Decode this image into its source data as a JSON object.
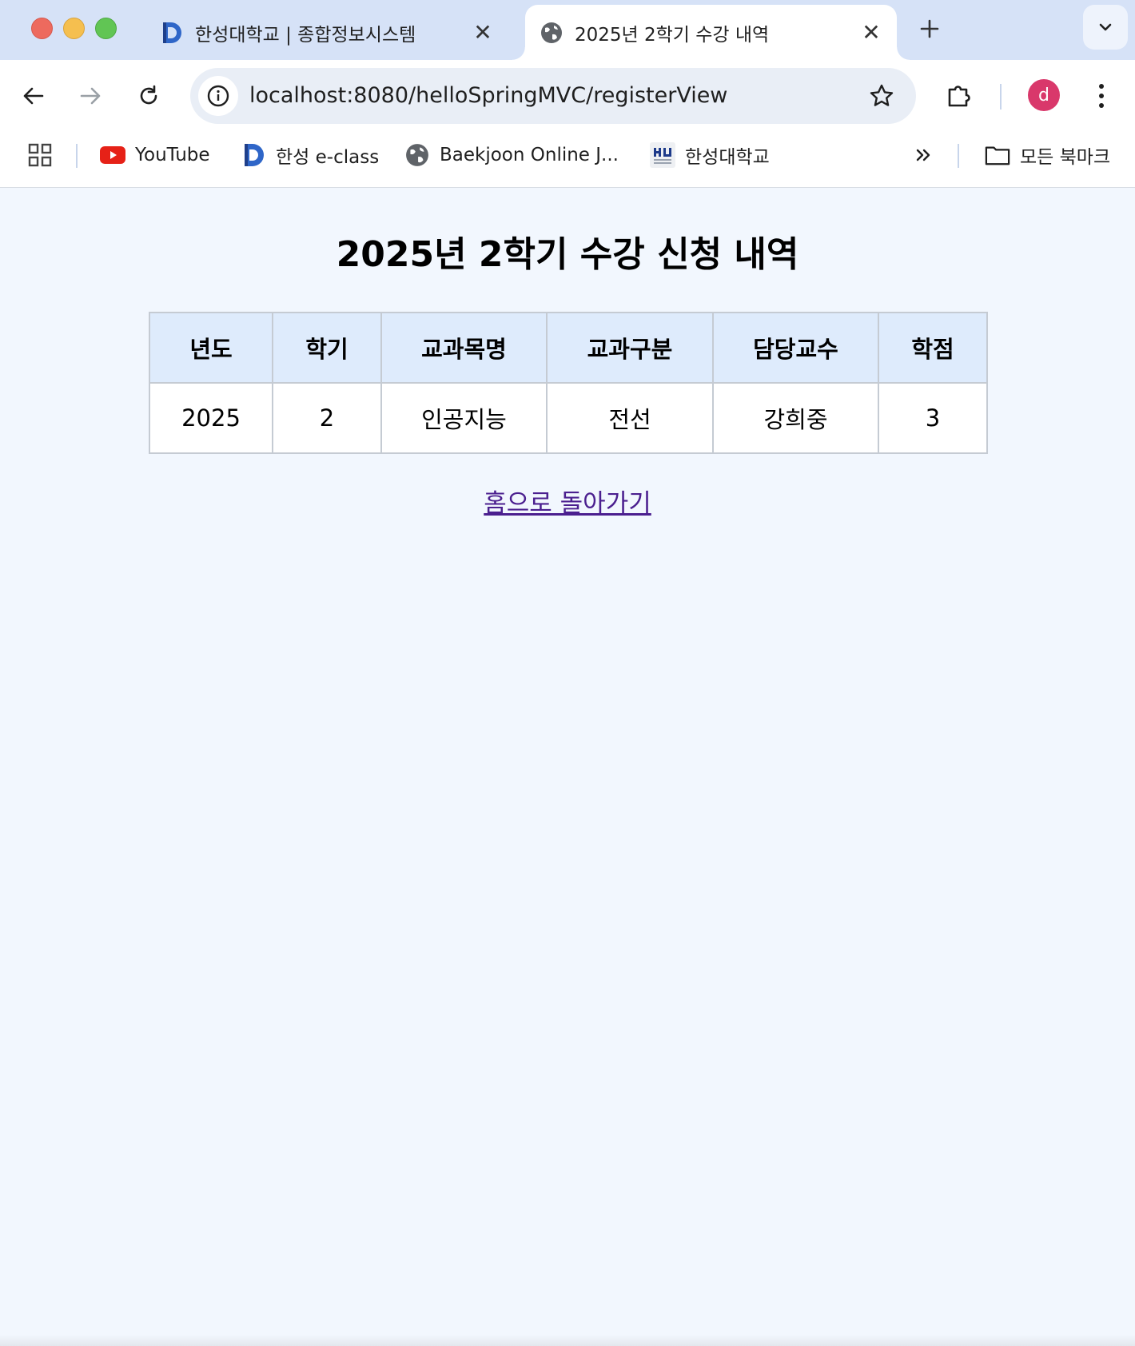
{
  "browser": {
    "tabs": [
      {
        "title": "한성대학교 | 종합정보시스템",
        "favicon": "hansung-eclass-logo-icon",
        "active": false
      },
      {
        "title": "2025년 2학기 수강 내역",
        "favicon": "globe-icon",
        "active": true
      }
    ],
    "url": "localhost:8080/helloSpringMVC/registerView",
    "profile_initial": "d",
    "bookmarks": [
      {
        "label": "YouTube",
        "icon": "youtube-icon"
      },
      {
        "label": "한성 e-class",
        "icon": "hansung-eclass-logo-icon"
      },
      {
        "label": "Baekjoon Online J...",
        "icon": "globe-icon"
      },
      {
        "label": "한성대학교",
        "icon": "hsu-logo-icon"
      }
    ],
    "all_bookmarks_label": "모든 북마크",
    "colors": {
      "tab_strip": "#d6e2f7",
      "omnibox": "#e9eef6",
      "avatar": "#d9386b"
    }
  },
  "page": {
    "title": "2025년 2학기 수강 신청 내역",
    "table": {
      "headers": [
        "년도",
        "학기",
        "교과목명",
        "교과구분",
        "담당교수",
        "학점"
      ],
      "rows": [
        [
          "2025",
          "2",
          "인공지능",
          "전선",
          "강희중",
          "3"
        ]
      ]
    },
    "home_link": "홈으로 돌아가기",
    "colors": {
      "background": "#f2f7fe",
      "header_bg": "#deebfc",
      "link": "#4b1f8f"
    }
  }
}
